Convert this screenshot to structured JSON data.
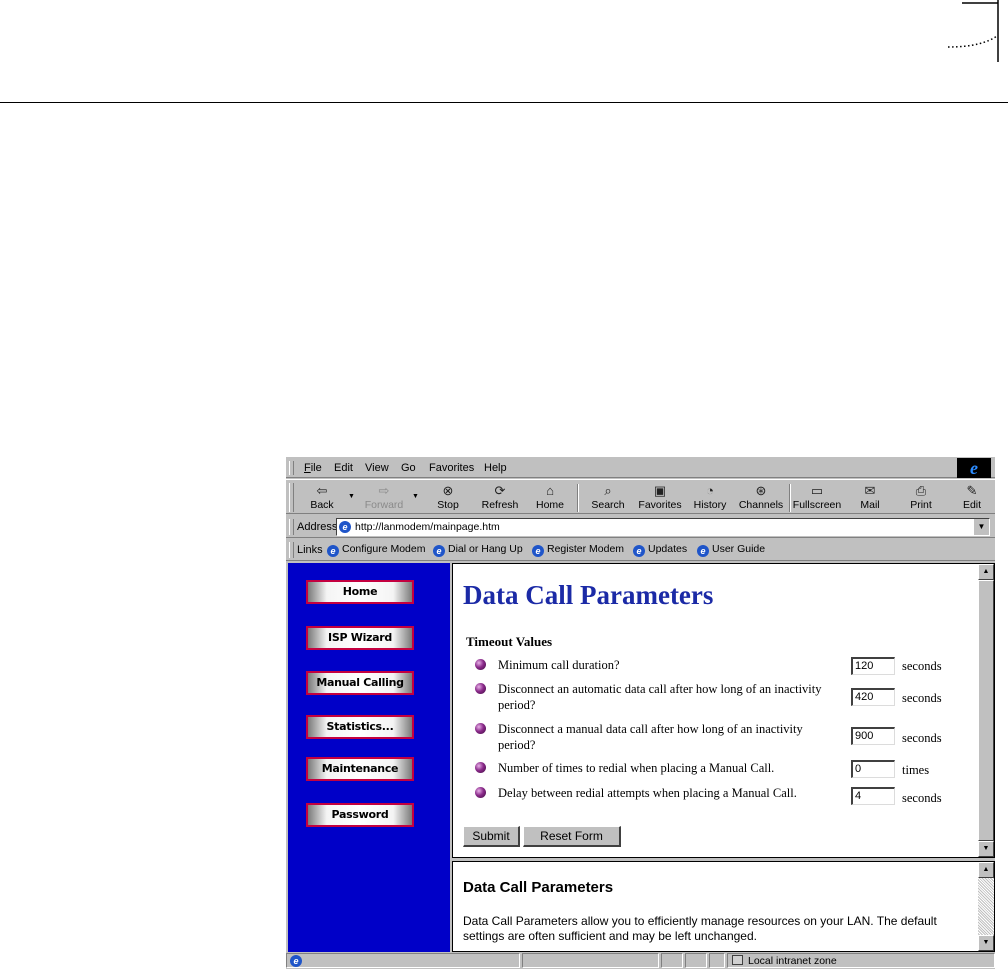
{
  "browser": {
    "menu": [
      "File",
      "Edit",
      "View",
      "Go",
      "Favorites",
      "Help"
    ],
    "toolbar": [
      {
        "label": "Back",
        "icon": "back-arrow-icon"
      },
      {
        "label": "Forward",
        "icon": "forward-arrow-icon"
      },
      {
        "label": "Stop",
        "icon": "stop-icon"
      },
      {
        "label": "Refresh",
        "icon": "refresh-icon"
      },
      {
        "label": "Home",
        "icon": "home-icon"
      },
      {
        "label": "Search",
        "icon": "search-icon"
      },
      {
        "label": "Favorites",
        "icon": "favorites-icon"
      },
      {
        "label": "History",
        "icon": "history-icon"
      },
      {
        "label": "Channels",
        "icon": "channels-icon"
      },
      {
        "label": "Fullscreen",
        "icon": "fullscreen-icon"
      },
      {
        "label": "Mail",
        "icon": "mail-icon"
      },
      {
        "label": "Print",
        "icon": "print-icon"
      },
      {
        "label": "Edit",
        "icon": "edit-icon"
      }
    ],
    "address_label": "Address",
    "address_url": "http://lanmodem/mainpage.htm",
    "links_label": "Links",
    "links": [
      "Configure Modem",
      "Dial or Hang Up",
      "Register Modem",
      "Updates",
      "User Guide"
    ],
    "status_zone": "Local intranet zone"
  },
  "sidebar": {
    "items": [
      "Home",
      "ISP Wizard",
      "Manual Calling",
      "Statistics...",
      "Maintenance",
      "Password"
    ]
  },
  "main": {
    "heading": "Data Call Parameters",
    "section_title": "Timeout Values",
    "params": [
      {
        "label": "Minimum call duration?",
        "value": "120",
        "unit": "seconds"
      },
      {
        "label": "Disconnect an automatic data call after how long of an inactivity period?",
        "value": "420",
        "unit": "seconds"
      },
      {
        "label": "Disconnect a manual data call after how long of an inactivity period?",
        "value": "900",
        "unit": "seconds"
      },
      {
        "label": "Number of times to redial when placing a Manual Call.",
        "value": "0",
        "unit": "times"
      },
      {
        "label": "Delay between redial attempts when placing a Manual Call.",
        "value": "4",
        "unit": "seconds"
      }
    ],
    "submit_label": "Submit",
    "reset_label": "Reset Form"
  },
  "help": {
    "heading": "Data Call Parameters",
    "text": "Data Call Parameters allow you to efficiently manage resources on your LAN. The default settings are often sufficient and may be left unchanged."
  },
  "colors": {
    "sidebar_bg": "#0000c8",
    "heading": "#1b2aa6",
    "nav_border": "#c40040"
  }
}
